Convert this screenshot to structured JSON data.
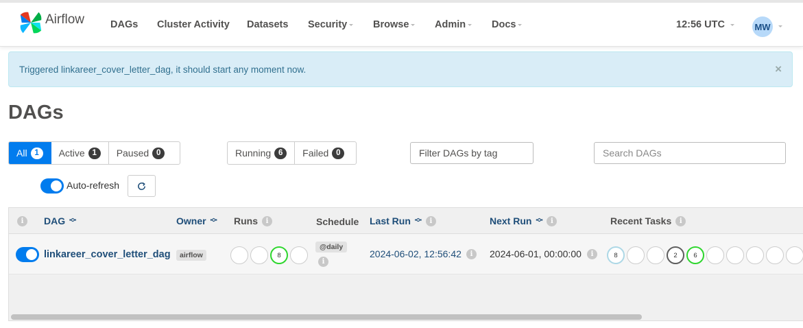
{
  "brand": {
    "name": "Airflow",
    "logo_icon": "airflow-pinwheel-logo"
  },
  "nav": {
    "items": [
      {
        "label": "DAGs",
        "dropdown": false
      },
      {
        "label": "Cluster Activity",
        "dropdown": false
      },
      {
        "label": "Datasets",
        "dropdown": false
      },
      {
        "label": "Security",
        "dropdown": true
      },
      {
        "label": "Browse",
        "dropdown": true
      },
      {
        "label": "Admin",
        "dropdown": true
      },
      {
        "label": "Docs",
        "dropdown": true
      }
    ],
    "time": "12:56 UTC",
    "user_initials": "MW"
  },
  "alert": {
    "message": "Triggered linkareer_cover_letter_dag, it should start any moment now.",
    "close": "×"
  },
  "page_title": "DAGs",
  "filters": {
    "status": [
      {
        "label": "All",
        "count": "1",
        "active": true
      },
      {
        "label": "Active",
        "count": "1",
        "active": false
      },
      {
        "label": "Paused",
        "count": "0",
        "active": false
      }
    ],
    "state": [
      {
        "label": "Running",
        "count": "6"
      },
      {
        "label": "Failed",
        "count": "0"
      }
    ],
    "tag_filter_value": "Filter DAGs by tag",
    "search_placeholder": "Search DAGs"
  },
  "auto_refresh": {
    "label": "Auto-refresh",
    "enabled": true
  },
  "table": {
    "headers": {
      "dag": "DAG",
      "owner": "Owner",
      "runs": "Runs",
      "schedule": "Schedule",
      "last_run": "Last Run",
      "next_run": "Next Run",
      "recent_tasks": "Recent Tasks"
    },
    "rows": [
      {
        "enabled": true,
        "dag_id": "linkareer_cover_letter_dag",
        "owner": "airflow",
        "runs": [
          "",
          "",
          "8",
          ""
        ],
        "schedule": "@daily",
        "last_run": "2024-06-02, 12:56:42",
        "next_run": "2024-06-01, 00:00:00",
        "recent_tasks": [
          "8",
          "",
          "",
          "2",
          "6",
          "",
          "",
          "",
          "",
          ""
        ]
      }
    ]
  },
  "colors": {
    "primary": "#017cee",
    "alert_bg": "#d9edf7",
    "running": "#2ed62e",
    "queued": "#add8e6",
    "upstream_failed": "#5e5e5e"
  }
}
